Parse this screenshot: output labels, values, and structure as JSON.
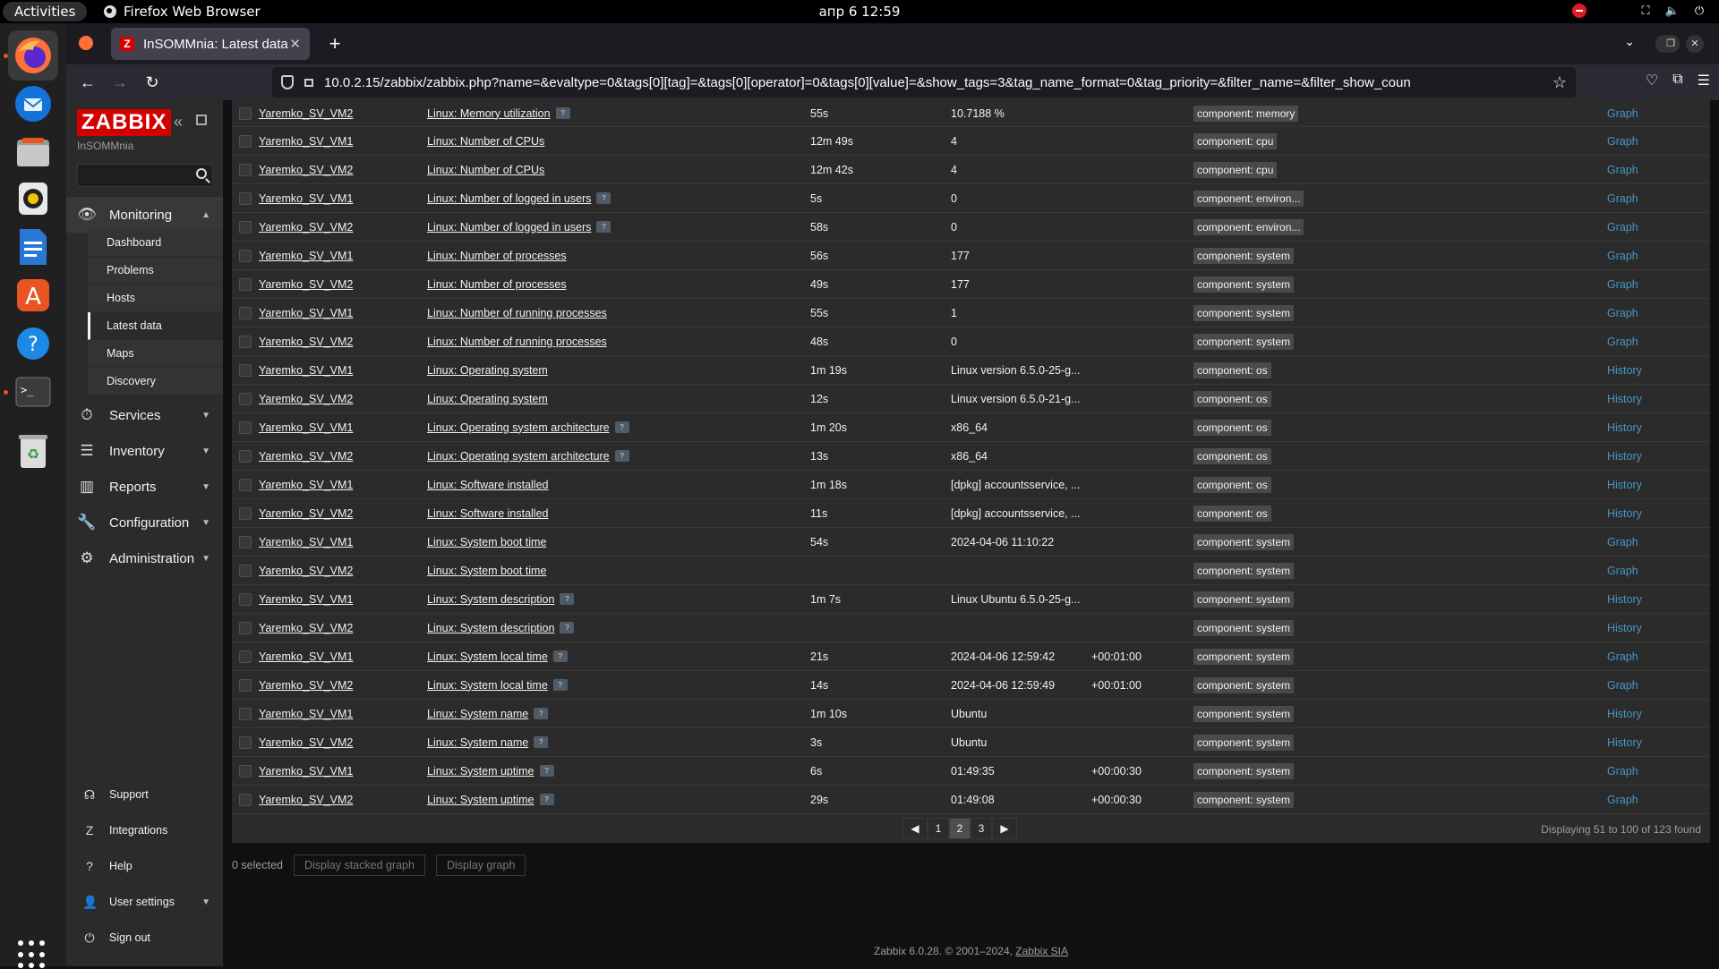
{
  "topbar": {
    "activities": "Activities",
    "app_name": "Firefox Web Browser",
    "clock": "апр 6  12:59"
  },
  "browser": {
    "tab_title": "InSOMMnia: Latest data",
    "tab_favicon_letter": "Z",
    "url": "10.0.2.15/zabbix/zabbix.php?name=&evaltype=0&tags[0][tag]=&tags[0][operator]=0&tags[0][value]=&show_tags=3&tag_name_format=0&tag_priority=&filter_name=&filter_show_coun"
  },
  "sidebar": {
    "logo": "ZABBIX",
    "server_name": "InSOMMnia",
    "search_value": "",
    "menu": [
      {
        "label": "Monitoring",
        "icon": "eye-icon"
      },
      {
        "label": "Services",
        "icon": "clock-icon"
      },
      {
        "label": "Inventory",
        "icon": "list-icon"
      },
      {
        "label": "Reports",
        "icon": "bar-chart-icon"
      },
      {
        "label": "Configuration",
        "icon": "wrench-icon"
      },
      {
        "label": "Administration",
        "icon": "gear-icon"
      }
    ],
    "monitoring_sub": [
      "Dashboard",
      "Problems",
      "Hosts",
      "Latest data",
      "Maps",
      "Discovery"
    ],
    "footer": [
      {
        "label": "Support",
        "icon": "headset-icon"
      },
      {
        "label": "Integrations",
        "icon": "z-icon"
      },
      {
        "label": "Help",
        "icon": "question-icon"
      },
      {
        "label": "User settings",
        "icon": "user-icon"
      },
      {
        "label": "Sign out",
        "icon": "power-icon"
      }
    ]
  },
  "table": {
    "rows": [
      {
        "host": "Yaremko_SV_VM2",
        "name": "Linux: Memory utilization",
        "help": true,
        "last": "55s",
        "value": "10.7188 %",
        "change": "",
        "tag": "component: memory",
        "link": "Graph"
      },
      {
        "host": "Yaremko_SV_VM1",
        "name": "Linux: Number of CPUs",
        "help": false,
        "last": "12m 49s",
        "value": "4",
        "change": "",
        "tag": "component: cpu",
        "link": "Graph"
      },
      {
        "host": "Yaremko_SV_VM2",
        "name": "Linux: Number of CPUs",
        "help": false,
        "last": "12m 42s",
        "value": "4",
        "change": "",
        "tag": "component: cpu",
        "link": "Graph"
      },
      {
        "host": "Yaremko_SV_VM1",
        "name": "Linux: Number of logged in users",
        "help": true,
        "last": "5s",
        "value": "0",
        "change": "",
        "tag": "component: environ...",
        "link": "Graph"
      },
      {
        "host": "Yaremko_SV_VM2",
        "name": "Linux: Number of logged in users",
        "help": true,
        "last": "58s",
        "value": "0",
        "change": "",
        "tag": "component: environ...",
        "link": "Graph"
      },
      {
        "host": "Yaremko_SV_VM1",
        "name": "Linux: Number of processes",
        "help": false,
        "last": "56s",
        "value": "177",
        "change": "",
        "tag": "component: system",
        "link": "Graph"
      },
      {
        "host": "Yaremko_SV_VM2",
        "name": "Linux: Number of processes",
        "help": false,
        "last": "49s",
        "value": "177",
        "change": "",
        "tag": "component: system",
        "link": "Graph"
      },
      {
        "host": "Yaremko_SV_VM1",
        "name": "Linux: Number of running processes",
        "help": false,
        "last": "55s",
        "value": "1",
        "change": "",
        "tag": "component: system",
        "link": "Graph"
      },
      {
        "host": "Yaremko_SV_VM2",
        "name": "Linux: Number of running processes",
        "help": false,
        "last": "48s",
        "value": "0",
        "change": "",
        "tag": "component: system",
        "link": "Graph"
      },
      {
        "host": "Yaremko_SV_VM1",
        "name": "Linux: Operating system",
        "help": false,
        "last": "1m 19s",
        "value": "Linux version 6.5.0-25-g...",
        "change": "",
        "tag": "component: os",
        "link": "History"
      },
      {
        "host": "Yaremko_SV_VM2",
        "name": "Linux: Operating system",
        "help": false,
        "last": "12s",
        "value": "Linux version 6.5.0-21-g...",
        "change": "",
        "tag": "component: os",
        "link": "History"
      },
      {
        "host": "Yaremko_SV_VM1",
        "name": "Linux: Operating system architecture",
        "help": true,
        "last": "1m 20s",
        "value": "x86_64",
        "change": "",
        "tag": "component: os",
        "link": "History"
      },
      {
        "host": "Yaremko_SV_VM2",
        "name": "Linux: Operating system architecture",
        "help": true,
        "last": "13s",
        "value": "x86_64",
        "change": "",
        "tag": "component: os",
        "link": "History"
      },
      {
        "host": "Yaremko_SV_VM1",
        "name": "Linux: Software installed",
        "help": false,
        "last": "1m 18s",
        "value": "[dpkg] accountsservice, ...",
        "change": "",
        "tag": "component: os",
        "link": "History"
      },
      {
        "host": "Yaremko_SV_VM2",
        "name": "Linux: Software installed",
        "help": false,
        "last": "11s",
        "value": "[dpkg] accountsservice, ...",
        "change": "",
        "tag": "component: os",
        "link": "History"
      },
      {
        "host": "Yaremko_SV_VM1",
        "name": "Linux: System boot time",
        "help": false,
        "last": "54s",
        "value": "2024-04-06 11:10:22",
        "change": "",
        "tag": "component: system",
        "link": "Graph"
      },
      {
        "host": "Yaremko_SV_VM2",
        "name": "Linux: System boot time",
        "help": false,
        "last": "",
        "value": "",
        "change": "",
        "tag": "component: system",
        "link": "Graph"
      },
      {
        "host": "Yaremko_SV_VM1",
        "name": "Linux: System description",
        "help": true,
        "last": "1m 7s",
        "value": "Linux Ubuntu 6.5.0-25-g...",
        "change": "",
        "tag": "component: system",
        "link": "History"
      },
      {
        "host": "Yaremko_SV_VM2",
        "name": "Linux: System description",
        "help": true,
        "last": "",
        "value": "",
        "change": "",
        "tag": "component: system",
        "link": "History"
      },
      {
        "host": "Yaremko_SV_VM1",
        "name": "Linux: System local time",
        "help": true,
        "last": "21s",
        "value": "2024-04-06 12:59:42",
        "change": "+00:01:00",
        "tag": "component: system",
        "link": "Graph"
      },
      {
        "host": "Yaremko_SV_VM2",
        "name": "Linux: System local time",
        "help": true,
        "last": "14s",
        "value": "2024-04-06 12:59:49",
        "change": "+00:01:00",
        "tag": "component: system",
        "link": "Graph"
      },
      {
        "host": "Yaremko_SV_VM1",
        "name": "Linux: System name",
        "help": true,
        "last": "1m 10s",
        "value": "Ubuntu",
        "change": "",
        "tag": "component: system",
        "link": "History"
      },
      {
        "host": "Yaremko_SV_VM2",
        "name": "Linux: System name",
        "help": true,
        "last": "3s",
        "value": "Ubuntu",
        "change": "",
        "tag": "component: system",
        "link": "History"
      },
      {
        "host": "Yaremko_SV_VM1",
        "name": "Linux: System uptime",
        "help": true,
        "last": "6s",
        "value": "01:49:35",
        "change": "+00:00:30",
        "tag": "component: system",
        "link": "Graph"
      },
      {
        "host": "Yaremko_SV_VM2",
        "name": "Linux: System uptime",
        "help": true,
        "last": "29s",
        "value": "01:49:08",
        "change": "+00:00:30",
        "tag": "component: system",
        "link": "Graph"
      }
    ]
  },
  "pager": {
    "pages": [
      "1",
      "2",
      "3"
    ],
    "current": "2",
    "prev": "◀",
    "next": "▶",
    "found_text": "Displaying 51 to 100 of 123 found"
  },
  "actions": {
    "selected_text": "0 selected",
    "stacked_graph": "Display stacked graph",
    "graph": "Display graph"
  },
  "footer": {
    "text": "Zabbix 6.0.28. © 2001–2024, ",
    "link": "Zabbix SIA"
  }
}
